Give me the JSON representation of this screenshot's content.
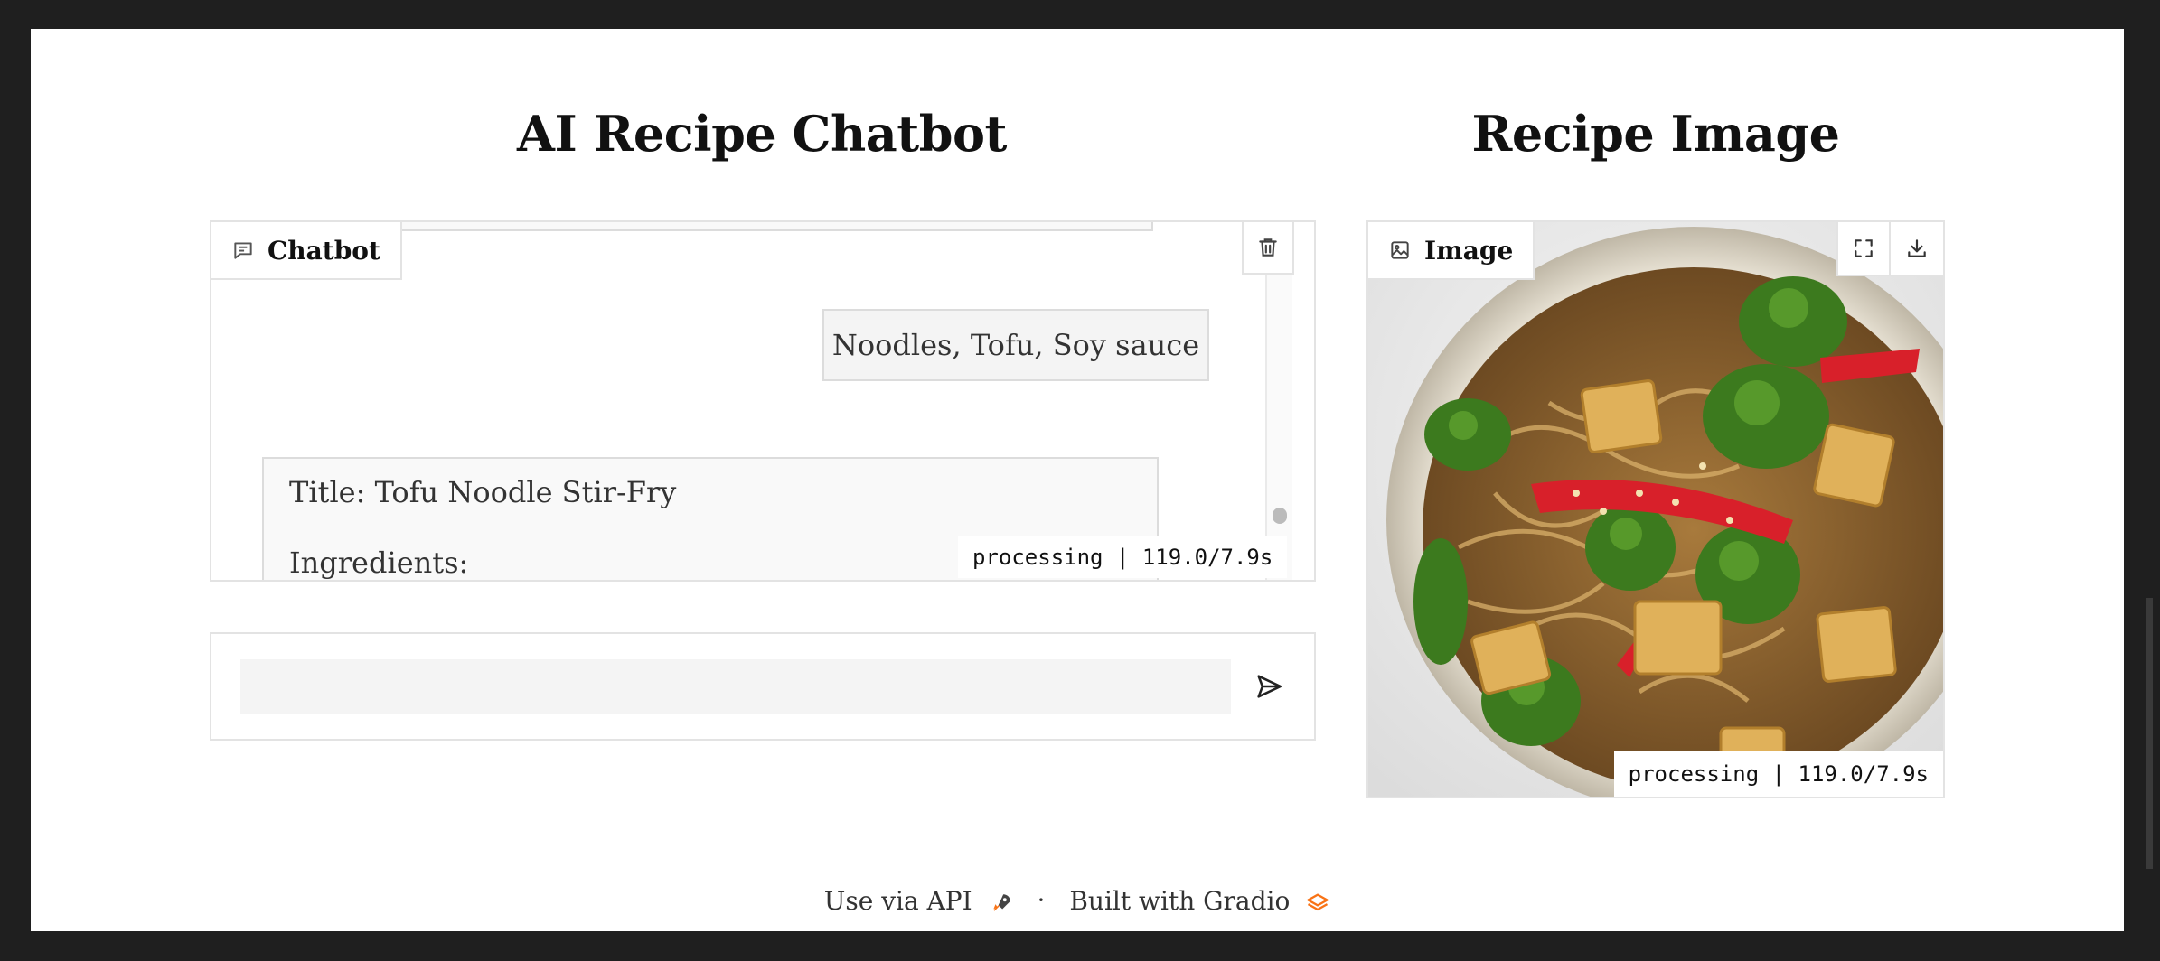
{
  "left_column": {
    "heading": "AI Recipe Chatbot",
    "chatbot": {
      "label": "Chatbot",
      "label_icon": "chat-bubble-icon",
      "clear_icon": "trash-icon",
      "user_message": "Noodles, Tofu, Soy sauce",
      "bot_message_line1": "Title: Tofu Noodle Stir-Fry",
      "bot_message_line2": "Ingredients:",
      "status": "processing | 119.0/7.9s"
    },
    "input": {
      "value": "",
      "placeholder": "",
      "submit_icon": "send-arrow-icon"
    }
  },
  "right_column": {
    "heading": "Recipe Image",
    "image": {
      "label": "Image",
      "label_icon": "image-icon",
      "fullscreen_icon": "fullscreen-icon",
      "download_icon": "download-icon",
      "status": "processing | 119.0/7.9s"
    }
  },
  "footer": {
    "api_link": "Use via API",
    "api_icon": "rocket-icon",
    "separator": "·",
    "built_with": "Built with Gradio",
    "gradio_icon": "gradio-logo-icon"
  },
  "colors": {
    "background": "#1f1f1f",
    "page": "#ffffff",
    "border": "#e3e3e3",
    "accent": "#f97316"
  }
}
